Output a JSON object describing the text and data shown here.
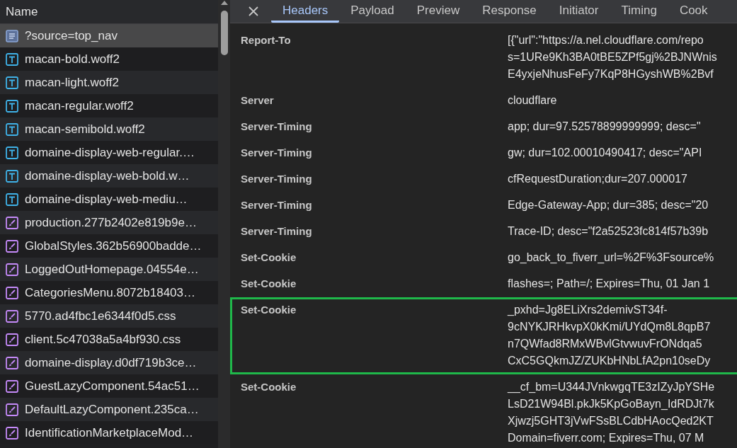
{
  "request_list": {
    "column_header": "Name",
    "items": [
      {
        "name": "?source=top_nav",
        "kind": "document",
        "selected": true
      },
      {
        "name": "macan-bold.woff2",
        "kind": "font",
        "selected": false
      },
      {
        "name": "macan-light.woff2",
        "kind": "font",
        "selected": false
      },
      {
        "name": "macan-regular.woff2",
        "kind": "font",
        "selected": false
      },
      {
        "name": "macan-semibold.woff2",
        "kind": "font",
        "selected": false
      },
      {
        "name": "domaine-display-web-regular.…",
        "kind": "font",
        "selected": false
      },
      {
        "name": "domaine-display-web-bold.w…",
        "kind": "font",
        "selected": false
      },
      {
        "name": "domaine-display-web-mediu…",
        "kind": "font",
        "selected": false
      },
      {
        "name": "production.277b2402e819b9e…",
        "kind": "stylesheet",
        "selected": false
      },
      {
        "name": "GlobalStyles.362b56900badde…",
        "kind": "stylesheet",
        "selected": false
      },
      {
        "name": "LoggedOutHomepage.04554e…",
        "kind": "stylesheet",
        "selected": false
      },
      {
        "name": "CategoriesMenu.8072b18403…",
        "kind": "stylesheet",
        "selected": false
      },
      {
        "name": "5770.ad4fbc1e6344f0d5.css",
        "kind": "stylesheet",
        "selected": false
      },
      {
        "name": "client.5c47038a5a4bf930.css",
        "kind": "stylesheet",
        "selected": false
      },
      {
        "name": "domaine-display.d0df719b3ce…",
        "kind": "stylesheet",
        "selected": false
      },
      {
        "name": "GuestLazyComponent.54ac51…",
        "kind": "stylesheet",
        "selected": false
      },
      {
        "name": "DefaultLazyComponent.235ca…",
        "kind": "stylesheet",
        "selected": false
      },
      {
        "name": "IdentificationMarketplaceMod…",
        "kind": "stylesheet",
        "selected": false
      }
    ]
  },
  "details": {
    "tabs": [
      {
        "label": "Headers",
        "selected": true
      },
      {
        "label": "Payload",
        "selected": false
      },
      {
        "label": "Preview",
        "selected": false
      },
      {
        "label": "Response",
        "selected": false
      },
      {
        "label": "Initiator",
        "selected": false
      },
      {
        "label": "Timing",
        "selected": false
      },
      {
        "label": "Cook",
        "selected": false
      }
    ],
    "headers": [
      {
        "name": "Report-To",
        "value_lines": [
          "[{\"url\":\"https://a.nel.cloudflare.com/repo",
          "s=1URe9Kh3BA0tBE5ZPf5gj%2BJNWnis",
          "E4yxjeNhusFeFy7KqP8HGyshWB%2Bvf"
        ],
        "highlighted": false
      },
      {
        "name": "Server",
        "value_lines": [
          "cloudflare"
        ],
        "highlighted": false
      },
      {
        "name": "Server-Timing",
        "value_lines": [
          "app; dur=97.52578899999999; desc=\""
        ],
        "highlighted": false
      },
      {
        "name": "Server-Timing",
        "value_lines": [
          "gw; dur=102.00010490417; desc=\"API"
        ],
        "highlighted": false
      },
      {
        "name": "Server-Timing",
        "value_lines": [
          "cfRequestDuration;dur=207.000017"
        ],
        "highlighted": false
      },
      {
        "name": "Server-Timing",
        "value_lines": [
          "Edge-Gateway-App; dur=385; desc=\"20"
        ],
        "highlighted": false
      },
      {
        "name": "Server-Timing",
        "value_lines": [
          "Trace-ID; desc=\"f2a52523fc814f57b39b"
        ],
        "highlighted": false
      },
      {
        "name": "Set-Cookie",
        "value_lines": [
          "go_back_to_fiverr_url=%2F%3Fsource%"
        ],
        "highlighted": false
      },
      {
        "name": "Set-Cookie",
        "value_lines": [
          "flashes=; Path=/; Expires=Thu, 01 Jan 1"
        ],
        "highlighted": false
      },
      {
        "name": "Set-Cookie",
        "value_lines": [
          "_pxhd=Jg8ELiXrs2demivST34f-",
          "9cNYKJRHkvpX0kKmi/UYdQm8L8qpB7",
          "n7QWfad8RMxWBvlGtvwuvFrONdqa5",
          "CxC5GQkmJZ/ZUKbHNbLfA2pn10seDy"
        ],
        "highlighted": true
      },
      {
        "name": "Set-Cookie",
        "value_lines": [
          "__cf_bm=U344JVnkwgqTE3zIZyJpYSHe",
          "LsD21W94Bl.pkJk5KpGoBayn_IdRDJt7k",
          "Xjwzj5GHT3jVwFSsBLCdbHAocQed2KT",
          "Domain=fiverr.com; Expires=Thu, 07 M"
        ],
        "highlighted": false
      }
    ]
  }
}
